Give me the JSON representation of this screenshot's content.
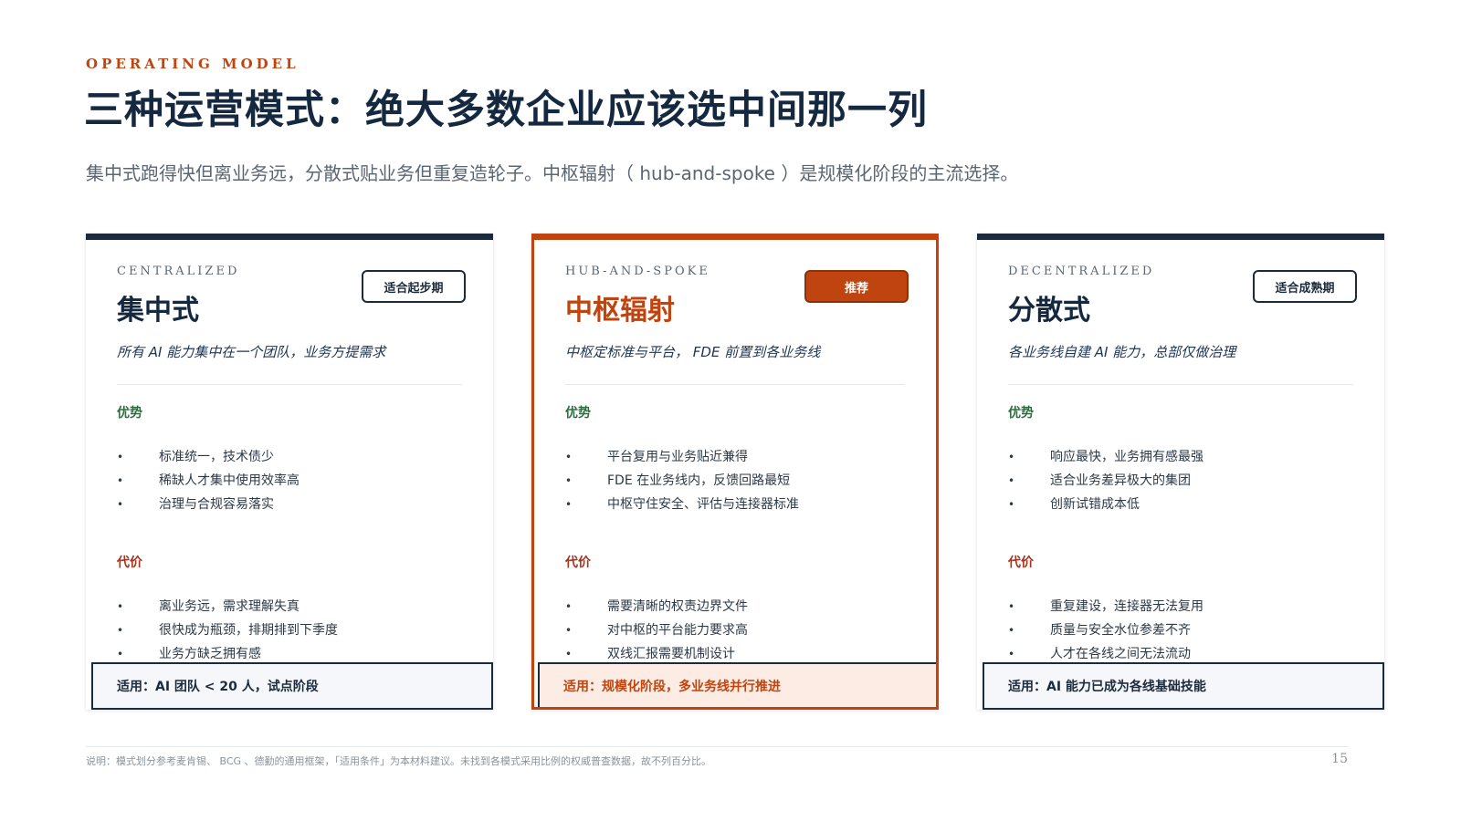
{
  "header": {
    "eyebrow": "OPERATING MODEL",
    "title": "三种运营模式：绝大多数企业应该选中间那一列",
    "subtitle": "集中式跑得快但离业务远，分散式贴业务但重复造轮子。中枢辐射（ hub-and-spoke ）是规模化阶段的主流选择。"
  },
  "cards": [
    {
      "kicker": "CENTRALIZED",
      "name": "集中式",
      "tag": "适合起步期",
      "desc": "所有 AI 能力集中在一个团队，业务方提需求",
      "pros_label": "优势",
      "pros": [
        "标准统一，技术债少",
        "稀缺人才集中使用效率高",
        "治理与合规容易落实"
      ],
      "cons_label": "代价",
      "cons": [
        "离业务远，需求理解失真",
        "很快成为瓶颈，排期排到下季度",
        "业务方缺乏拥有感"
      ],
      "apply": "适用：AI 团队 < 20 人，试点阶段"
    },
    {
      "kicker": "HUB-AND-SPOKE",
      "name": "中枢辐射",
      "tag": "推荐",
      "desc": "中枢定标准与平台， FDE 前置到各业务线",
      "pros_label": "优势",
      "pros": [
        "平台复用与业务贴近兼得",
        "FDE 在业务线内，反馈回路最短",
        "中枢守住安全、评估与连接器标准"
      ],
      "cons_label": "代价",
      "cons": [
        "需要清晰的权责边界文件",
        "对中枢的平台能力要求高",
        "双线汇报需要机制设计"
      ],
      "apply": "适用：规模化阶段，多业务线并行推进"
    },
    {
      "kicker": "DECENTRALIZED",
      "name": "分散式",
      "tag": "适合成熟期",
      "desc": "各业务线自建 AI 能力，总部仅做治理",
      "pros_label": "优势",
      "pros": [
        "响应最快，业务拥有感最强",
        "适合业务差异极大的集团",
        "创新试错成本低"
      ],
      "cons_label": "代价",
      "cons": [
        "重复建设，连接器无法复用",
        "质量与安全水位参差不齐",
        "人才在各线之间无法流动"
      ],
      "apply": "适用：AI 能力已成为各线基础技能"
    }
  ],
  "footer": {
    "note": "说明：模式划分参考麦肯锡、 BCG 、德勤的通用框架，「适用条件」为本材料建议。未找到各模式采用比例的权威普查数据，故不列百分比。",
    "page": "15"
  },
  "colors": {
    "accent": "#c0440f",
    "navy": "#14283f",
    "pro": "#2b6e3f",
    "con": "#a8321c"
  }
}
